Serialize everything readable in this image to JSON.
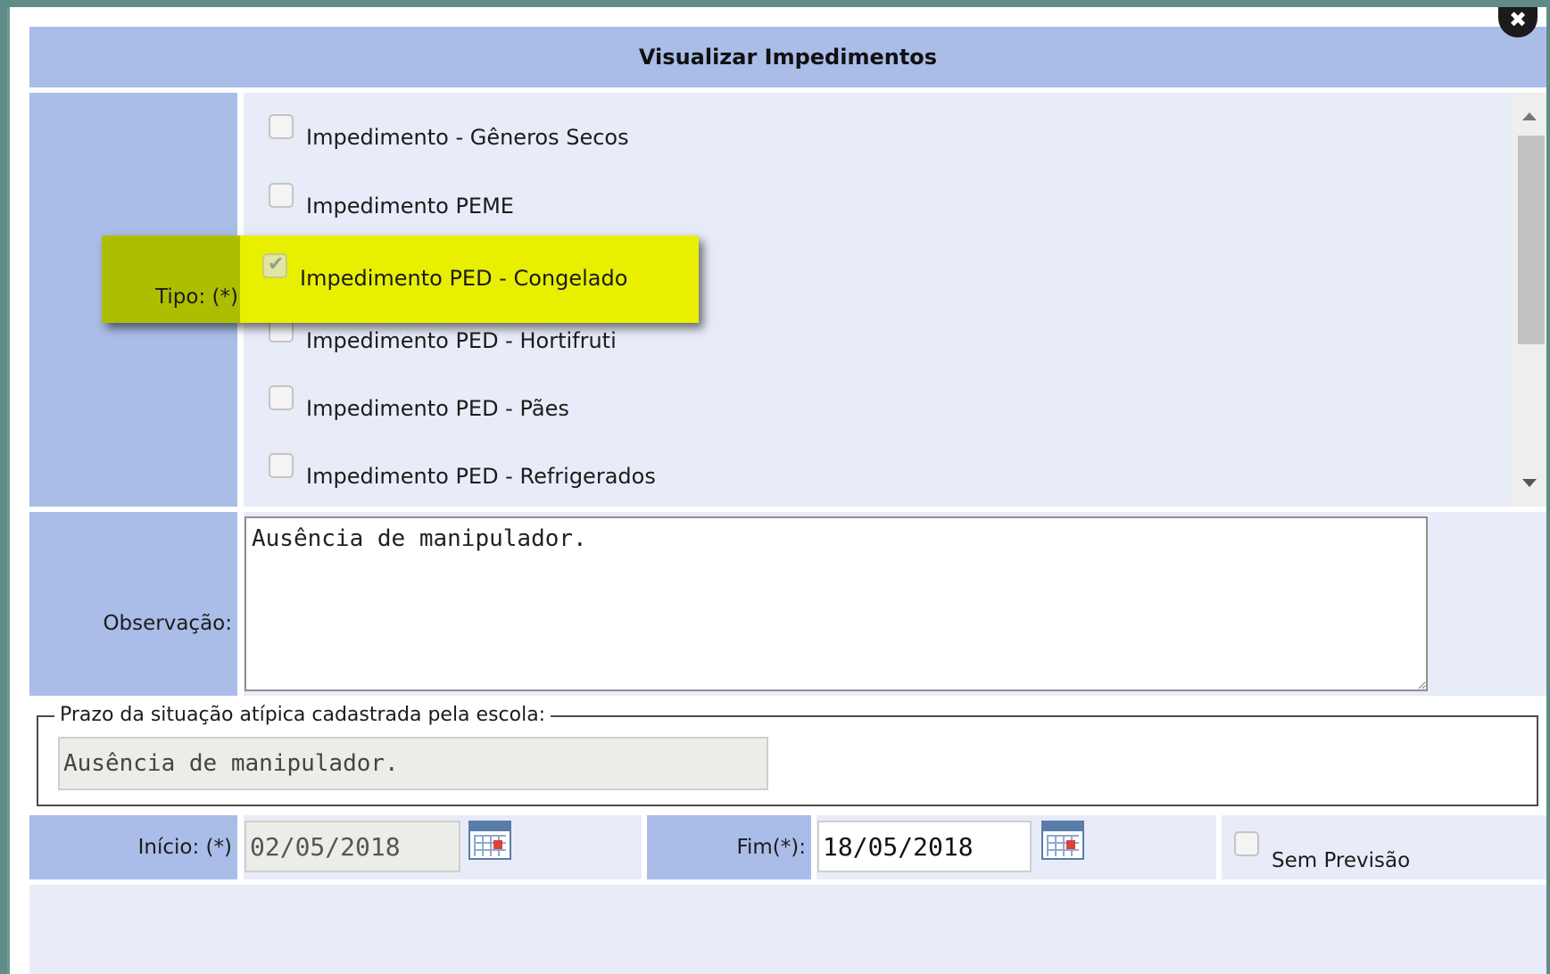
{
  "dialog": {
    "title": "Visualizar Impedimentos",
    "close_glyph": "✖"
  },
  "tipo": {
    "label": "Tipo: (*)",
    "options": [
      {
        "label": "Impedimento - Gêneros Secos",
        "checked": false
      },
      {
        "label": "Impedimento PEME",
        "checked": false
      },
      {
        "label": "Impedimento PED - Congelado",
        "checked": true
      },
      {
        "label": "Impedimento PED - Hortifruti",
        "checked": false
      },
      {
        "label": "Impedimento PED - Pães",
        "checked": false
      },
      {
        "label": "Impedimento PED - Refrigerados",
        "checked": false
      }
    ]
  },
  "observacao": {
    "label": "Observação:",
    "value": "Ausência de manipulador."
  },
  "prazo": {
    "legend": "Prazo da situação atípica cadastrada pela escola:",
    "value": "Ausência de manipulador."
  },
  "inicio": {
    "label": "Início: (*)",
    "value": "02/05/2018"
  },
  "fim": {
    "label": "Fim(*):",
    "value": "18/05/2018"
  },
  "sem_previsao": {
    "label": "Sem Previsão",
    "checked": false
  },
  "colors": {
    "header_blue": "#a9bde8",
    "row_light": "#e8ecf8",
    "highlight_yellow": "#e9ef00"
  }
}
